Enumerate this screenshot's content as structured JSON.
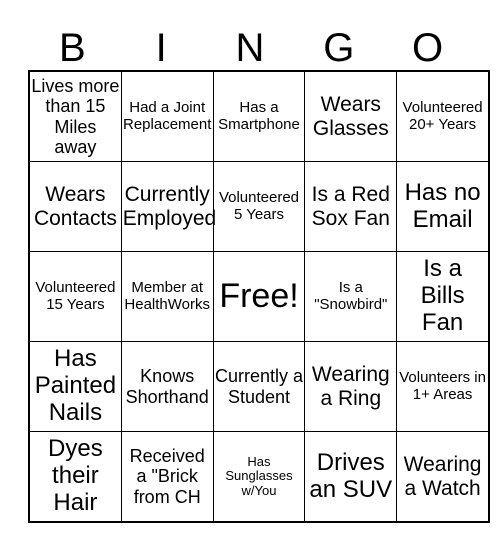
{
  "card": {
    "title_letters": [
      "B",
      "I",
      "N",
      "G",
      "O"
    ],
    "rows": [
      [
        {
          "text": "Lives more than 15 Miles away",
          "size": "fs-m"
        },
        {
          "text": "Had a Joint Replacement",
          "size": "fs-s"
        },
        {
          "text": "Has a Smartphone",
          "size": "fs-s"
        },
        {
          "text": "Wears Glasses",
          "size": "fs-l"
        },
        {
          "text": "Volunteered 20+ Years",
          "size": "fs-s"
        }
      ],
      [
        {
          "text": "Wears Contacts",
          "size": "fs-l"
        },
        {
          "text": "Currently Employed",
          "size": "fs-l"
        },
        {
          "text": "Volunteered 5 Years",
          "size": "fs-s"
        },
        {
          "text": "Is a Red Sox Fan",
          "size": "fs-l"
        },
        {
          "text": "Has no Email",
          "size": "fs-xl"
        }
      ],
      [
        {
          "text": "Volunteered 15 Years",
          "size": "fs-s"
        },
        {
          "text": "Member at HealthWorks",
          "size": "fs-s"
        },
        {
          "text": "Free!",
          "size": "fs-free"
        },
        {
          "text": "Is a \"Snowbird\"",
          "size": "fs-s"
        },
        {
          "text": "Is a Bills Fan",
          "size": "fs-xl"
        }
      ],
      [
        {
          "text": "Has Painted Nails",
          "size": "fs-xl"
        },
        {
          "text": "Knows Shorthand",
          "size": "fs-m"
        },
        {
          "text": "Currently a Student",
          "size": "fs-m"
        },
        {
          "text": "Wearing a Ring",
          "size": "fs-l"
        },
        {
          "text": "Volunteers in 1+ Areas",
          "size": "fs-s"
        }
      ],
      [
        {
          "text": "Dyes their Hair",
          "size": "fs-xl"
        },
        {
          "text": "Received a \"Brick from CH",
          "size": "fs-m"
        },
        {
          "text": "Has Sunglasses w/You",
          "size": "fs-xs"
        },
        {
          "text": "Drives an SUV",
          "size": "fs-xl"
        },
        {
          "text": "Wearing a Watch",
          "size": "fs-l"
        }
      ]
    ]
  }
}
